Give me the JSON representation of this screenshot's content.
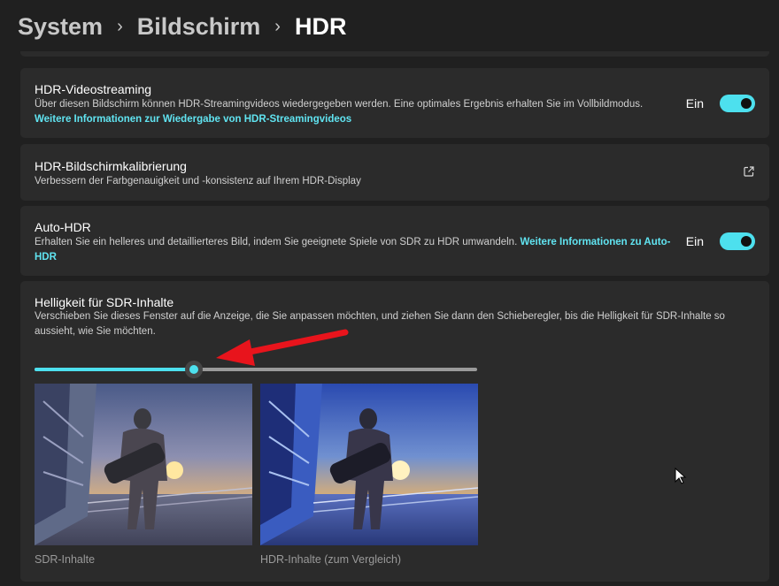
{
  "breadcrumb": {
    "level1": "System",
    "level2": "Bildschirm",
    "current": "HDR",
    "separator": "›"
  },
  "hdr_video": {
    "title": "HDR-Videostreaming",
    "description": "Über diesen Bildschirm können HDR-Streamingvideos wiedergegeben werden. Eine optimales Ergebnis erhalten Sie im Vollbildmodus.",
    "link": "Weitere Informationen zur Wiedergabe von HDR-Streamingvideos",
    "toggle_label": "Ein",
    "toggle_on": true
  },
  "calibration": {
    "title": "HDR-Bildschirmkalibrierung",
    "description": "Verbessern der Farbgenauigkeit und -konsistenz auf Ihrem HDR-Display",
    "icon": "open-external-icon"
  },
  "auto_hdr": {
    "title": "Auto-HDR",
    "description": "Erhalten Sie ein helleres und detaillierteres Bild, indem Sie geeignete Spiele von SDR zu HDR umwandeln.",
    "link": "Weitere Informationen zu Auto-HDR",
    "toggle_label": "Ein",
    "toggle_on": true
  },
  "sdr_brightness": {
    "title": "Helligkeit für SDR-Inhalte",
    "description": "Verschieben Sie dieses Fenster auf die Anzeige, die Sie anpassen möchten, und ziehen Sie dann den Schieberegler, bis die Helligkeit für SDR-Inhalte so aussieht, wie Sie möchten.",
    "slider_fraction": 0.36,
    "sdr_caption": "SDR-Inhalte",
    "hdr_caption": "HDR-Inhalte (zum Vergleich)"
  },
  "colors": {
    "accent": "#4de0ee",
    "link": "#60e3f0",
    "card": "#2b2b2b",
    "background": "#202020",
    "annotation_arrow": "#e8141c"
  }
}
